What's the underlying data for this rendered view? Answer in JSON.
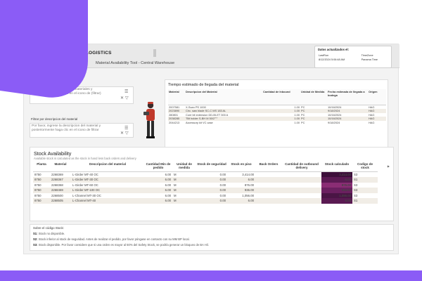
{
  "header": {
    "brand": "2 LOGISTICS",
    "subtitle": "Material Availability Tool - Central Warehouse",
    "dates_title": "Datos actualizados el:",
    "dates": {
      "col1_header": "LastRun",
      "col2_header": "TimeZone",
      "col1_value": "8/12/2024 5:06:48 AM",
      "col2_value": "Panama Time"
    }
  },
  "filters": {
    "material_label": "Filtrar por Material:",
    "material_placeholder": "Por favor, ingrese la lista de materiales y posteriormente haga clic en el icono de (filtrar)",
    "description_label": "Filtrar por descripcion del material",
    "description_placeholder": "Por favor, ingrese la descripcion del material y posteriormente haga clic en el icono de filtrar"
  },
  "eta": {
    "title": "Tiempo estimado de llegada del material",
    "columns": [
      "Material",
      "Descripcion del Material",
      "Cantidad de Inbound",
      "Unidad de Medida",
      "Fecha estimada de llegada a bodega",
      "Origen"
    ],
    "rows": [
      [
        "2007581",
        "X-Scan PS 1000",
        "1.00",
        "PC",
        "10/16/2024",
        "HAG"
      ],
      [
        "2023890",
        "Circ. saw blade SC-C MS 183 AL",
        "1.00",
        "PC",
        "9/18/2024",
        "HAG"
      ],
      [
        "280801",
        "Core bit extension DD-BI-ET 300 A",
        "1.00",
        "PC",
        "10/16/2024",
        "HAG"
      ],
      [
        "2038285",
        "\"Bit holder S-BH M 50/2\"\"\"",
        "1.00",
        "PC",
        "10/16/2024",
        "HAG"
      ],
      [
        "2044213",
        "Accessory kit VC case",
        "1.00",
        "PC",
        "9/18/2024",
        "HAG"
      ]
    ]
  },
  "stock": {
    "title": "Stock Availability",
    "subtitle": "Available stock is calculated as the stock in hand less back orders and delivery",
    "columns": [
      "Planta",
      "Material",
      "Descripcion del material",
      "Cantidad Min de pedido",
      "Unidad de medida",
      "Stock de seguridad",
      "Stock en piso",
      "Back Orders",
      "Cantidad de outbound delivery",
      "Stock calculado",
      "Codigo de stock"
    ],
    "rows": [
      [
        "8750",
        "2268369",
        "L-Girder MT-40 OC",
        "6.00",
        "M",
        "0.00",
        "3,414.00",
        "",
        "",
        "3,414.00",
        "S3"
      ],
      [
        "8750",
        "2268367",
        "L-Girder MT-30 OC",
        "6.00",
        "M",
        "0.00",
        "6.00",
        "",
        "",
        "6.00",
        "S1"
      ],
      [
        "8750",
        "2268368",
        "L-Girder MT-60 OC",
        "6.00",
        "M",
        "0.00",
        "876.00",
        "",
        "",
        "876.00",
        "S3"
      ],
      [
        "8750",
        "2268469",
        "L-Girder MT-100 OC",
        "6.00",
        "M",
        "0.00",
        "936.00",
        "",
        "",
        "936.00",
        "S3"
      ],
      [
        "8750",
        "2268500",
        "L-Channel MT-30 OC",
        "6.00",
        "M",
        "0.00",
        "1,056.00",
        "",
        "",
        "1,056.00",
        "S3"
      ],
      [
        "8750",
        "2268505",
        "L-Channel MT-40",
        "6.00",
        "M",
        "0.00",
        "6.00",
        "",
        "",
        "6.00",
        "S1"
      ]
    ],
    "calc_colors": [
      "#3d0f3a",
      "#5a1a52",
      "#8a2d74",
      "#6b2060",
      "#4a1545",
      "#5a1a52"
    ]
  },
  "legend": {
    "title": "Sobre el código Stock:",
    "s1_code": "S1:",
    "s1_text": "Stock no disponible.",
    "s2_code": "S2:",
    "s2_text": "Stock inferior al stock de seguridad. Antes de realizar el pedido, por favor póngase en contacto con su MM BP local.",
    "s3_code": "S3:",
    "s3_text": "Stock disponible. Por favor considere que si una orden es mayor al 50% del Safety Stock, se podría generar un bloqueo de BA Hil."
  },
  "colors": {
    "accent_purple": "#8b5cf6",
    "calc_dark": "#5a1a52"
  }
}
